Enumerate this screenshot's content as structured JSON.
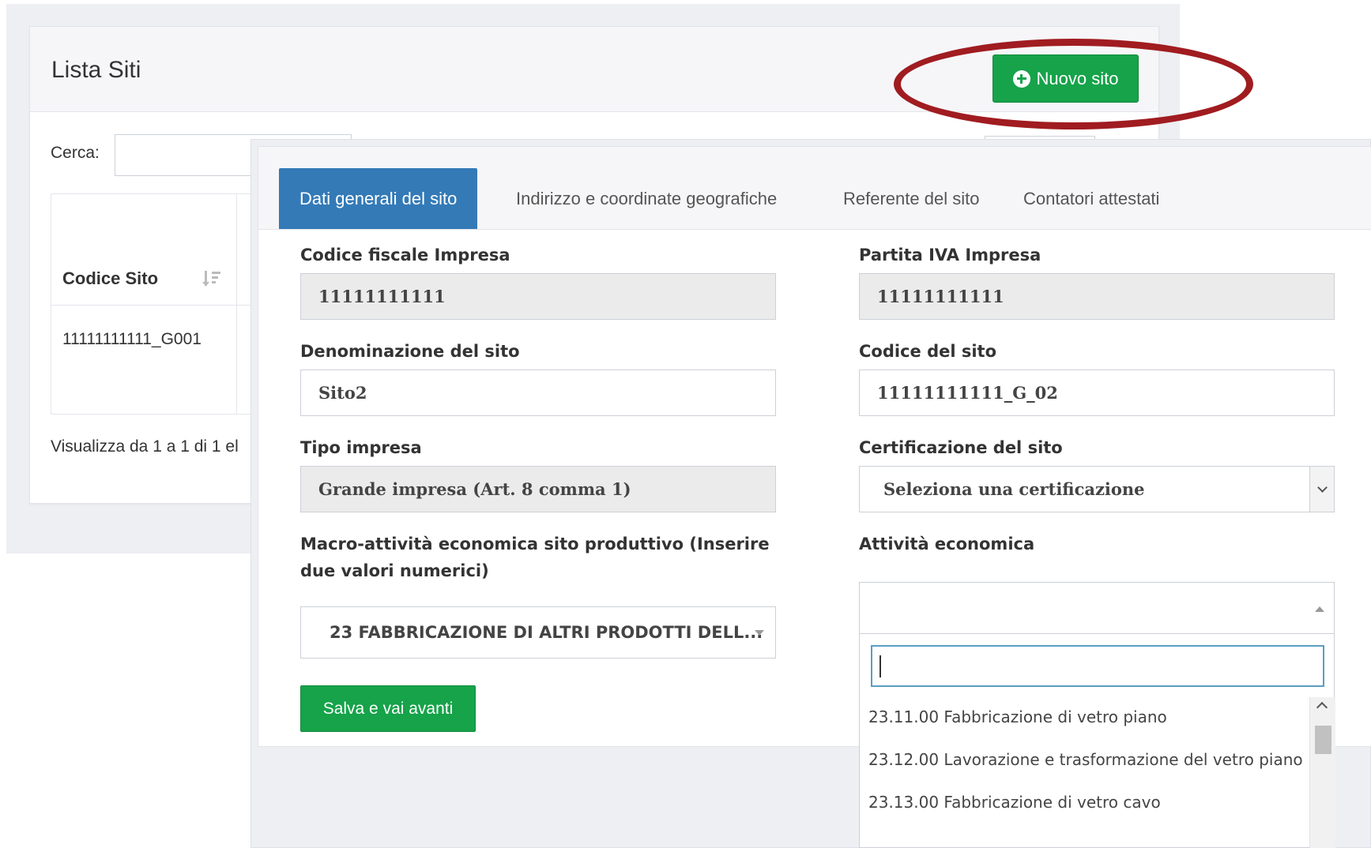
{
  "list": {
    "title": "Lista Siti",
    "new_button_label": "Nuovo sito",
    "search_label": "Cerca:",
    "table": {
      "headers": [
        "Codice Sito"
      ],
      "rows": [
        [
          "11111111111_G001"
        ]
      ]
    },
    "footer_info": "Visualizza da 1 a 1 di 1 el"
  },
  "modal": {
    "tabs": [
      {
        "label": "Dati generali del sito",
        "active": true
      },
      {
        "label": "Indirizzo e coordinate geografiche",
        "active": false
      },
      {
        "label": "Referente del sito",
        "active": false
      },
      {
        "label": "Contatori attestati",
        "active": false
      }
    ],
    "fields": {
      "codice_fiscale": {
        "label": "Codice fiscale Impresa",
        "value": "11111111111"
      },
      "partita_iva": {
        "label": "Partita IVA Impresa",
        "value": "11111111111"
      },
      "denominazione": {
        "label": "Denominazione del sito",
        "value": "Sito2"
      },
      "codice_sito": {
        "label": "Codice del sito",
        "value": "11111111111_G_02"
      },
      "tipo_impresa": {
        "label": "Tipo impresa",
        "value": "Grande impresa (Art. 8 comma 1)"
      },
      "certificazione": {
        "label": "Certificazione del sito",
        "value": "Seleziona una certificazione"
      },
      "macro_attivita": {
        "label": "Macro-attività economica sito produttivo (Inserire due valori numerici)",
        "value": "23 FABBRICAZIONE DI ALTRI PRODOTTI DELL..."
      },
      "attivita": {
        "label": "Attività economica",
        "search_value": "",
        "options": [
          "23.11.00 Fabbricazione di vetro piano",
          "23.12.00 Lavorazione e trasformazione del vetro piano",
          "23.13.00 Fabbricazione di vetro cavo"
        ]
      }
    },
    "save_button_label": "Salva e vai avanti"
  },
  "colors": {
    "primary_tab": "#337ab7",
    "success_button": "#16a34a",
    "highlight_ellipse": "#a01c20"
  }
}
